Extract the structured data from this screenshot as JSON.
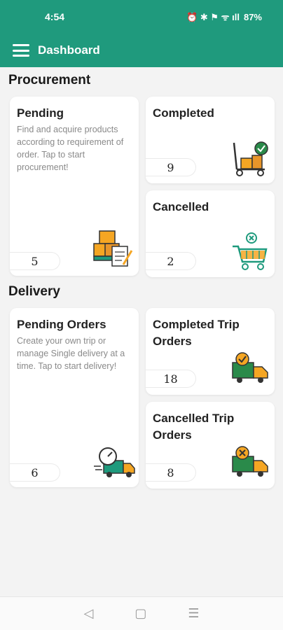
{
  "status": {
    "time": "4:54",
    "indicators": "⏰ ✱ ⚑ ᯤ ıll",
    "battery": "87%"
  },
  "appbar": {
    "title": "Dashboard"
  },
  "procurement": {
    "title": "Procurement",
    "pending": {
      "title": "Pending",
      "description": "Find and acquire products according to requirement of order. Tap to start procurement!",
      "count": "5"
    },
    "completed": {
      "title": "Completed",
      "count": "9"
    },
    "cancelled": {
      "title": "Cancelled",
      "count": "2"
    }
  },
  "delivery": {
    "title": "Delivery",
    "pending": {
      "title": "Pending Orders",
      "description": "Create your own trip or manage Single delivery at a time. Tap to start delivery!",
      "count": "6"
    },
    "completed": {
      "title": "Completed Trip Orders",
      "count": "18"
    },
    "cancelled": {
      "title": "Cancelled Trip Orders",
      "count": "8"
    }
  },
  "icons": {
    "menu": "menu-icon",
    "boxes_checklist": "boxes-clipboard-icon",
    "trolley_check": "hand-trolley-check-icon",
    "cart_cancel": "shopping-cart-cancel-icon",
    "speed_truck": "speedometer-truck-icon",
    "truck_check": "truck-check-icon",
    "truck_cancel": "truck-cancel-icon"
  },
  "navbar": {
    "back": "◁",
    "home": "▢",
    "recents": "☰"
  },
  "colors": {
    "primary": "#1f9a7d",
    "accent": "#f5a623",
    "truck_green": "#2a8a4a"
  }
}
